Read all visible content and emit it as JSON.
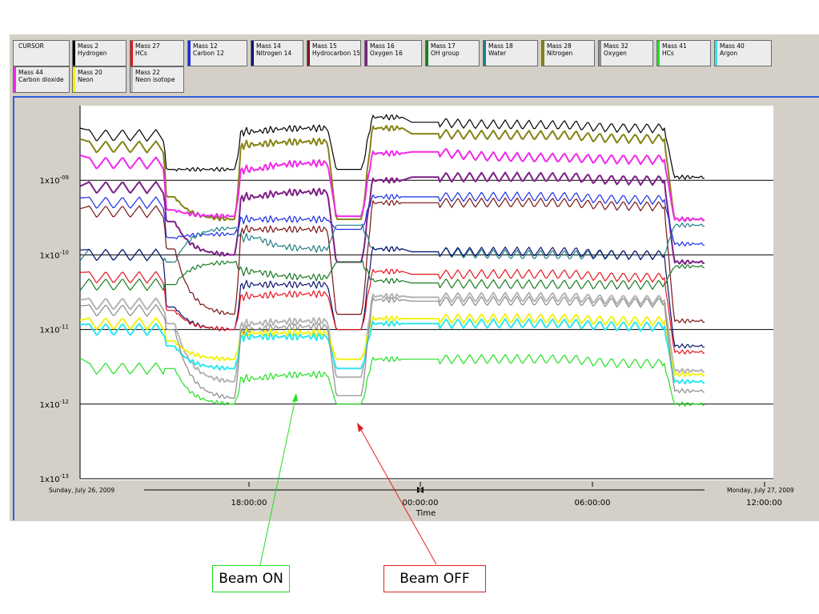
{
  "legend": {
    "cursor_label": "CURSOR",
    "items": [
      {
        "mass": "Mass 2",
        "name": "Hydrogen",
        "color": "#000000"
      },
      {
        "mass": "Mass 27",
        "name": "HCs",
        "color": "#e8141e"
      },
      {
        "mass": "Mass 12",
        "name": "Carbon 12",
        "color": "#1a2ee6"
      },
      {
        "mass": "Mass 14",
        "name": "Nitrogen 14",
        "color": "#0c1470"
      },
      {
        "mass": "Mass 15",
        "name": "Hydrocarbon 15",
        "color": "#7a1414"
      },
      {
        "mass": "Mass 16",
        "name": "Oxygen 16",
        "color": "#7d1f86"
      },
      {
        "mass": "Mass 17",
        "name": "OH group",
        "color": "#1a7a24"
      },
      {
        "mass": "Mass 18",
        "name": "Water",
        "color": "#1f7f86"
      },
      {
        "mass": "Mass 28",
        "name": "Nitrogen",
        "color": "#858214"
      },
      {
        "mass": "Mass 32",
        "name": "Oxygen",
        "color": "#8a8a8a"
      },
      {
        "mass": "Mass 41",
        "name": "HCs",
        "color": "#22e022"
      },
      {
        "mass": "Mass 40",
        "name": "Argon",
        "color": "#2fe6f0"
      },
      {
        "mass": "Mass 44",
        "name": "Carbon dioxide",
        "color": "#f028e8"
      },
      {
        "mass": "Mass 20",
        "name": "Neon",
        "color": "#f2f214"
      },
      {
        "mass": "Mass 22",
        "name": "Neon isotope",
        "color": "#b4b4b4"
      }
    ]
  },
  "annotations": {
    "beam_on": {
      "label": "Beam ON",
      "color": "#22dd22"
    },
    "beam_off": {
      "label": "Beam OFF",
      "color": "#e62020"
    }
  },
  "chart_data": {
    "type": "line",
    "x_start_label": "Sunday, July 26, 2009",
    "x_end_label": "Monday, July 27, 2009",
    "x_ticks": [
      "18:00:00",
      "00:00:00",
      "06:00:00",
      "12:00:00"
    ],
    "xlabel": "Time",
    "yscale": "log",
    "ylim": [
      1e-13,
      1e-08
    ],
    "y_ticks": [
      {
        "base": "1x10",
        "exp": "-09",
        "value": 1e-09
      },
      {
        "base": "1x10",
        "exp": "-10",
        "value": 1e-10
      },
      {
        "base": "1x10",
        "exp": "-11",
        "value": 1e-11
      },
      {
        "base": "1x10",
        "exp": "-12",
        "value": 1e-12
      },
      {
        "base": "1x10",
        "exp": "-13",
        "value": 1e-13
      }
    ],
    "x_hours": [
      12.8,
      14.0,
      15.7,
      16.1,
      18.2,
      19.0,
      21.4,
      22.6,
      24.0,
      25.3,
      30.0,
      33.1,
      34.5
    ],
    "series": [
      {
        "name": "Hydrogen",
        "color": "#000000",
        "values": [
          6e-09,
          4e-09,
          4e-09,
          1.4e-09,
          1.4e-09,
          4.5e-09,
          5e-09,
          1.4e-09,
          7e-09,
          6e-09,
          5.5e-09,
          5e-09,
          1.1e-09
        ]
      },
      {
        "name": "Nitrogen",
        "color": "#858214",
        "values": [
          4.3e-09,
          2.8e-09,
          2.8e-09,
          6e-10,
          3e-10,
          3e-09,
          3.3e-09,
          3e-10,
          5e-09,
          4.2e-09,
          4e-09,
          3.6e-09,
          3e-10
        ]
      },
      {
        "name": "Carbon dioxide",
        "color": "#f028e8",
        "values": [
          2.6e-09,
          1.7e-09,
          1.7e-09,
          4e-10,
          3.3e-10,
          1.4e-09,
          1.7e-09,
          3.3e-10,
          2.3e-09,
          2.4e-09,
          2e-09,
          1.9e-09,
          3e-10
        ]
      },
      {
        "name": "Oxygen 16",
        "color": "#7d1f86",
        "values": [
          1e-09,
          8e-10,
          8e-10,
          2.8e-10,
          1e-10,
          6e-10,
          7e-10,
          8e-11,
          1e-09,
          1.1e-09,
          1.1e-09,
          1e-09,
          8e-11
        ]
      },
      {
        "name": "Carbon 12",
        "color": "#1a2ee6",
        "values": [
          7e-10,
          5e-10,
          5e-10,
          1.7e-10,
          1.9e-10,
          3e-10,
          3e-10,
          2.2e-10,
          6e-10,
          6e-10,
          6e-10,
          5.5e-10,
          1.4e-10
        ]
      },
      {
        "name": "Hydrocarbon 15",
        "color": "#7a1414",
        "values": [
          5e-10,
          3.8e-10,
          3.8e-10,
          1.2e-10,
          1.6e-11,
          2.2e-10,
          2.2e-10,
          1.6e-11,
          5e-10,
          5e-10,
          5e-10,
          4.5e-10,
          1.3e-11
        ]
      },
      {
        "name": "Water",
        "color": "#1f7f86",
        "values": [
          1e-10,
          1e-10,
          1e-10,
          8e-11,
          2.3e-10,
          1.7e-10,
          1.2e-10,
          2.5e-10,
          1.2e-10,
          1.1e-10,
          1e-10,
          1e-10,
          2.5e-10
        ]
      },
      {
        "name": "Nitrogen 14",
        "color": "#0c1470",
        "values": [
          1.4e-10,
          1e-10,
          1e-10,
          2e-11,
          1e-11,
          4e-11,
          4e-11,
          1e-11,
          1.2e-10,
          1.1e-10,
          1.1e-10,
          1e-10,
          6e-12
        ]
      },
      {
        "name": "HCs",
        "color": "#e8141e",
        "values": [
          7e-11,
          5e-11,
          5e-11,
          1.8e-11,
          1e-11,
          2.8e-11,
          3e-11,
          1e-11,
          6e-11,
          5.5e-11,
          5.5e-11,
          5e-11,
          5e-12
        ]
      },
      {
        "name": "OH group",
        "color": "#1a7a24",
        "values": [
          4e-11,
          4e-11,
          4e-11,
          4e-11,
          8e-11,
          6e-11,
          5e-11,
          8e-11,
          4.5e-11,
          4.2e-11,
          4e-11,
          4e-11,
          7e-11
        ]
      },
      {
        "name": "Neon isotope",
        "color": "#b4b4b4",
        "values": [
          3e-11,
          2.2e-11,
          2.2e-11,
          1.2e-11,
          2e-12,
          1.2e-11,
          1.3e-11,
          2.3e-12,
          2.8e-11,
          2.7e-11,
          2.7e-11,
          2.5e-11,
          2.8e-12
        ]
      },
      {
        "name": "Neon",
        "color": "#f2f214",
        "values": [
          1.6e-11,
          1.2e-11,
          1.2e-11,
          7e-12,
          4e-12,
          9e-12,
          9e-12,
          4e-12,
          1.4e-11,
          1.4e-11,
          1.4e-11,
          1.3e-11,
          2.5e-12
        ]
      },
      {
        "name": "Argon",
        "color": "#2fe6f0",
        "values": [
          1.4e-11,
          1e-11,
          1e-11,
          6e-12,
          3e-12,
          8e-12,
          8e-12,
          3e-12,
          1.2e-11,
          1.2e-11,
          1.2e-11,
          1.1e-11,
          2e-12
        ]
      },
      {
        "name": "Oxygen",
        "color": "#8a8a8a",
        "values": [
          2.5e-11,
          1.8e-11,
          1.8e-11,
          1e-11,
          1.2e-12,
          1e-11,
          1.1e-11,
          1.3e-12,
          2.5e-11,
          2.4e-11,
          2.4e-11,
          2.3e-11,
          1.5e-12
        ]
      },
      {
        "name": "HCs",
        "color": "#22e022",
        "values": [
          5e-12,
          3e-12,
          3e-12,
          3e-12,
          1e-12,
          2.2e-12,
          2.5e-12,
          1e-12,
          4e-12,
          4e-12,
          4e-12,
          3.5e-12,
          1e-12
        ]
      }
    ]
  }
}
